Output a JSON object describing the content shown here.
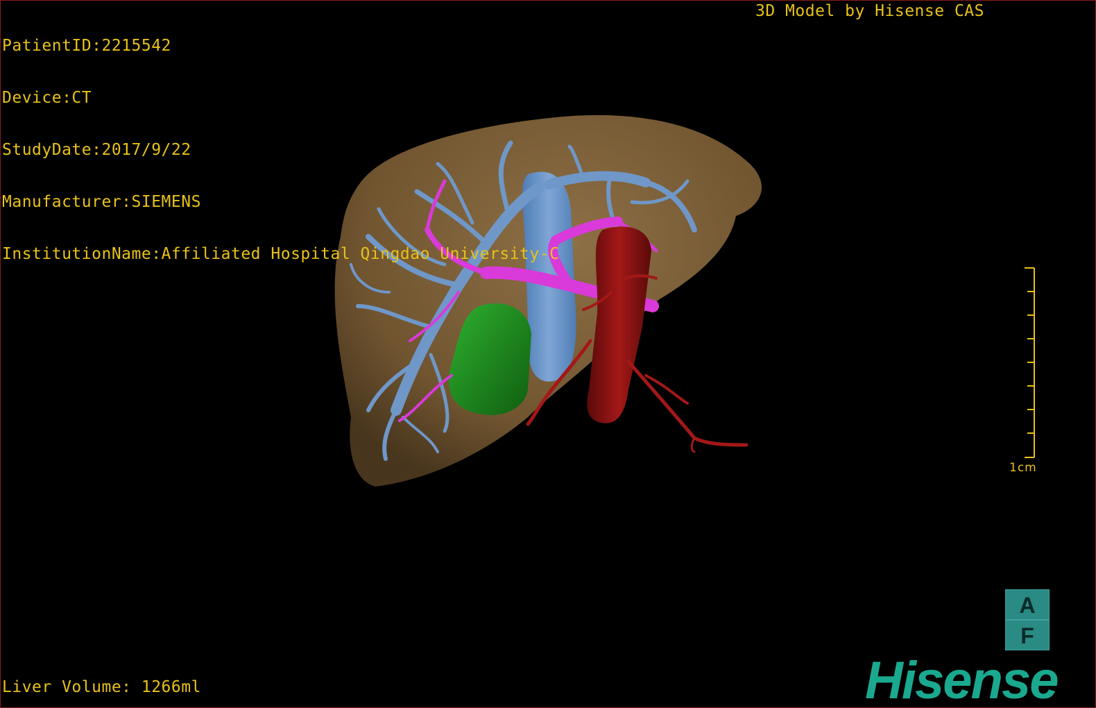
{
  "header": {
    "patient_id": "PatientID:2215542",
    "device": "Device:CT",
    "study_date": "StudyDate:2017/9/22",
    "manufacturer": "Manufacturer:SIEMENS",
    "institution": "InstitutionName:Affiliated Hospital Qingdao University-C",
    "brand_line": "3D Model by Hisense CAS"
  },
  "footer": {
    "liver_volume": "Liver Volume: 1266ml"
  },
  "scale": {
    "label": "1cm"
  },
  "orientation": {
    "top_face": "A",
    "bottom_face": "F"
  },
  "logo": {
    "text": "Hisense"
  },
  "colors": {
    "text": "#e8c21a",
    "liver": "#8a6a3e",
    "portal_vein": "#6f97c8",
    "hepatic_artery": "#d93ad9",
    "gallbladder": "#1d8a1d",
    "inferior_vena_cava": "#8c1414",
    "brand": "#1aa98f"
  }
}
